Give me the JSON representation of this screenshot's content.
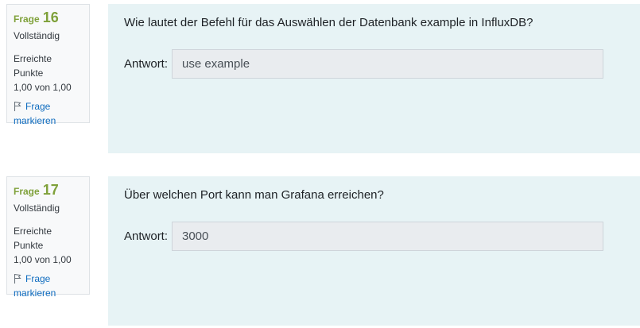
{
  "questions": [
    {
      "label": "Frage",
      "number": "16",
      "state": "Vollständig",
      "grade_line1": "Erreichte Punkte",
      "grade_line2": "1,00 von 1,00",
      "flag_line1": "Frage",
      "flag_line2": "markieren",
      "text": "Wie lautet der Befehl für das Auswählen der Datenbank example in InfluxDB?",
      "answer_label": "Antwort:",
      "answer_value": "use example"
    },
    {
      "label": "Frage",
      "number": "17",
      "state": "Vollständig",
      "grade_line1": "Erreichte Punkte",
      "grade_line2": "1,00 von 1,00",
      "flag_line1": "Frage",
      "flag_line2": "markieren",
      "text": "Über welchen Port kann man Grafana erreichen?",
      "answer_label": "Antwort:",
      "answer_value": "3000"
    }
  ],
  "colors": {
    "accent_green": "#7fa13a",
    "link_blue": "#0f6cbf",
    "content_bg": "#e7f3f5",
    "input_bg": "#e9ecef"
  },
  "icons": {
    "flag": "flag-outline-icon"
  }
}
